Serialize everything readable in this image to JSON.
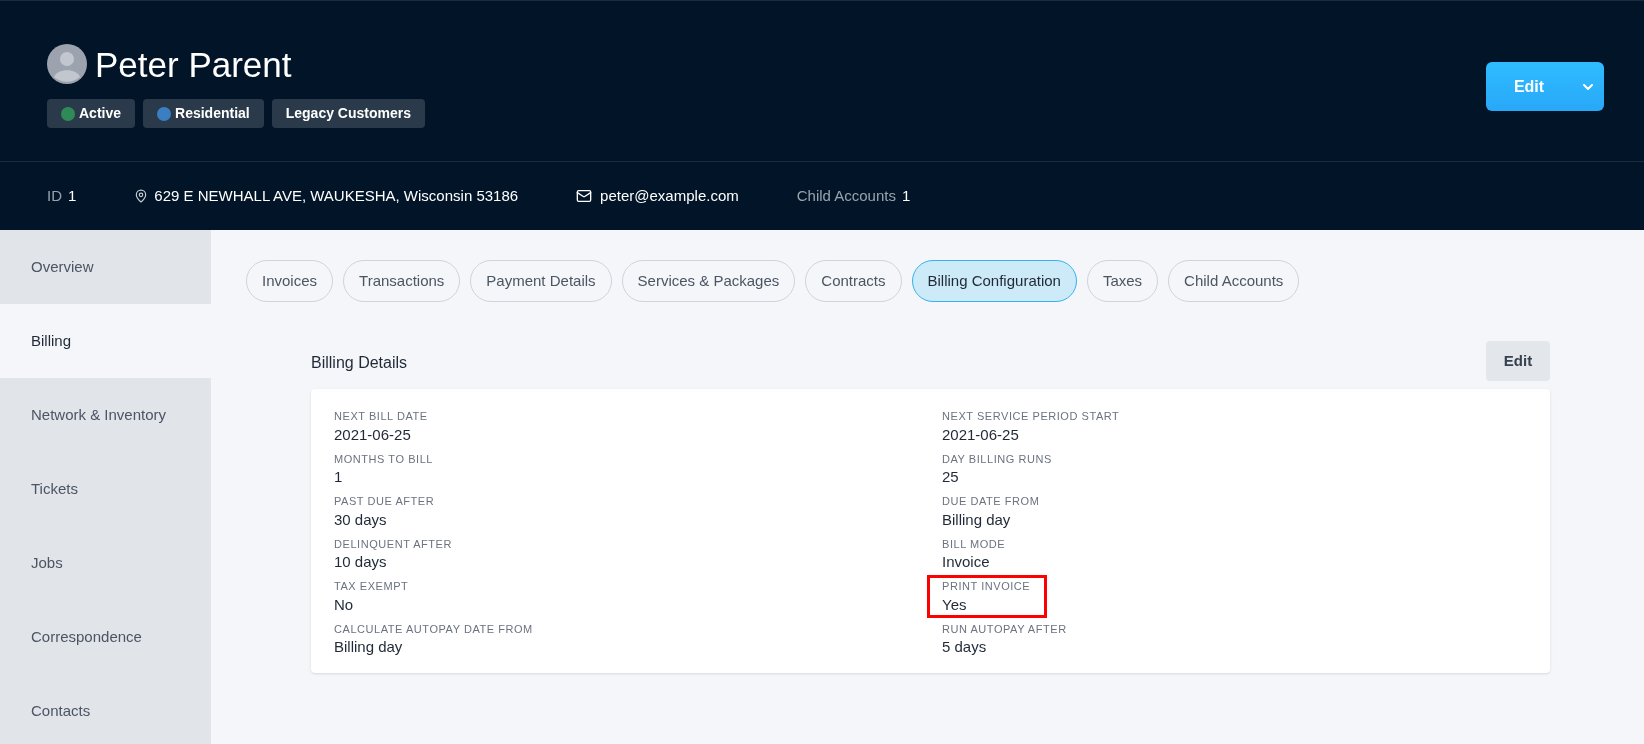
{
  "customer": {
    "name": "Peter Parent",
    "tags": [
      {
        "label": "Active",
        "color": "#2e8b57"
      },
      {
        "label": "Residential",
        "color": "#3a7fc1"
      },
      {
        "label": "Legacy Customers"
      }
    ]
  },
  "edit_button": {
    "label": "Edit"
  },
  "info_bar": [
    {
      "kind": "id",
      "label": "ID",
      "value": "1"
    },
    {
      "kind": "address",
      "value": "629 E NEWHALL AVE, WAUKESHA, Wisconsin 53186"
    },
    {
      "kind": "email",
      "value": "peter@example.com"
    },
    {
      "kind": "count",
      "label": "Child Accounts",
      "value": "1"
    }
  ],
  "sidebar": {
    "items": [
      {
        "label": "Overview",
        "selected": false
      },
      {
        "label": "Billing",
        "selected": true
      },
      {
        "label": "Network & Inventory",
        "selected": false
      },
      {
        "label": "Tickets",
        "selected": false
      },
      {
        "label": "Jobs",
        "selected": false
      },
      {
        "label": "Correspondence",
        "selected": false
      },
      {
        "label": "Contacts",
        "selected": false
      }
    ]
  },
  "tabs": [
    {
      "label": "Invoices",
      "selected": false
    },
    {
      "label": "Transactions",
      "selected": false
    },
    {
      "label": "Payment Details",
      "selected": false
    },
    {
      "label": "Services & Packages",
      "selected": false
    },
    {
      "label": "Contracts",
      "selected": false
    },
    {
      "label": "Billing Configuration",
      "selected": true
    },
    {
      "label": "Taxes",
      "selected": false
    },
    {
      "label": "Child Accounts",
      "selected": false
    }
  ],
  "billing_details": {
    "title": "Billing Details",
    "edit_label": "Edit",
    "fields": [
      {
        "label": "NEXT BILL DATE",
        "value": "2021-06-25",
        "highlighted": false
      },
      {
        "label": "NEXT SERVICE PERIOD START",
        "value": "2021-06-25",
        "highlighted": false
      },
      {
        "label": "MONTHS TO BILL",
        "value": "1",
        "highlighted": false
      },
      {
        "label": "DAY BILLING RUNS",
        "value": "25",
        "highlighted": false
      },
      {
        "label": "PAST DUE AFTER",
        "value": "30 days",
        "highlighted": false
      },
      {
        "label": "DUE DATE FROM",
        "value": "Billing day",
        "highlighted": false
      },
      {
        "label": "DELINQUENT AFTER",
        "value": "10 days",
        "highlighted": false
      },
      {
        "label": "BILL MODE",
        "value": "Invoice",
        "highlighted": false
      },
      {
        "label": "TAX EXEMPT",
        "value": "No",
        "highlighted": false
      },
      {
        "label": "PRINT INVOICE",
        "value": "Yes",
        "highlighted": true
      },
      {
        "label": "CALCULATE AUTOPAY DATE FROM",
        "value": "Billing day",
        "highlighted": false
      },
      {
        "label": "RUN AUTOPAY AFTER",
        "value": "5 days",
        "highlighted": false
      }
    ]
  }
}
